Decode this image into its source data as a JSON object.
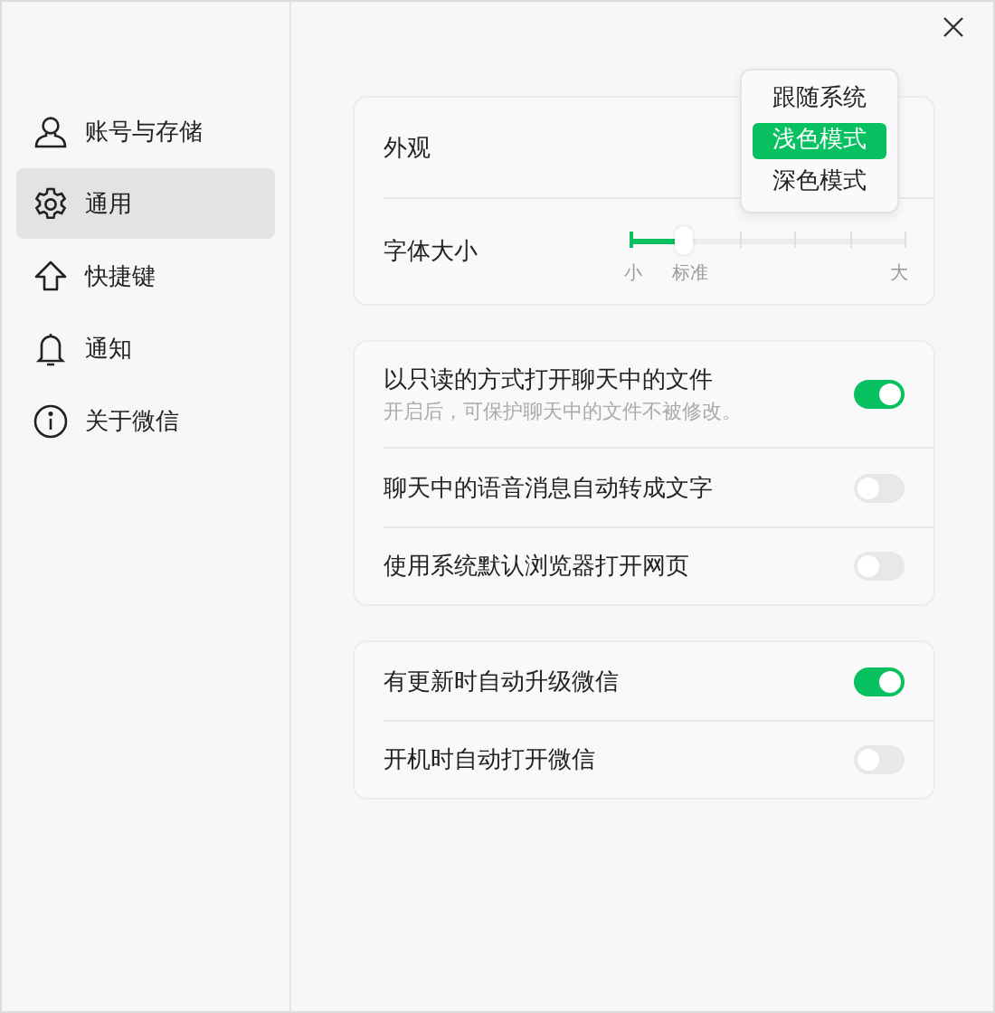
{
  "sidebar": {
    "items": [
      {
        "label": "账号与存储",
        "selected": false
      },
      {
        "label": "通用",
        "selected": true
      },
      {
        "label": "快捷键",
        "selected": false
      },
      {
        "label": "通知",
        "selected": false
      },
      {
        "label": "关于微信",
        "selected": false
      }
    ]
  },
  "appearance": {
    "label": "外观",
    "menu": [
      {
        "label": "跟随系统",
        "selected": false
      },
      {
        "label": "浅色模式",
        "selected": true
      },
      {
        "label": "深色模式",
        "selected": false
      }
    ]
  },
  "font_size": {
    "label": "字体大小",
    "level": 0.2,
    "min_label": "小",
    "current_label": "标准",
    "max_label": "大"
  },
  "cards": [
    {
      "rows": [
        {
          "label": "以只读的方式打开聊天中的文件",
          "hint": "开启后，可保护聊天中的文件不被修改。",
          "on": true
        },
        {
          "label": "聊天中的语音消息自动转成文字",
          "on": false
        },
        {
          "label": "使用系统默认浏览器打开网页",
          "on": false
        }
      ]
    },
    {
      "rows": [
        {
          "label": "有更新时自动升级微信",
          "on": true
        },
        {
          "label": "开机时自动打开微信",
          "on": false
        }
      ]
    }
  ]
}
